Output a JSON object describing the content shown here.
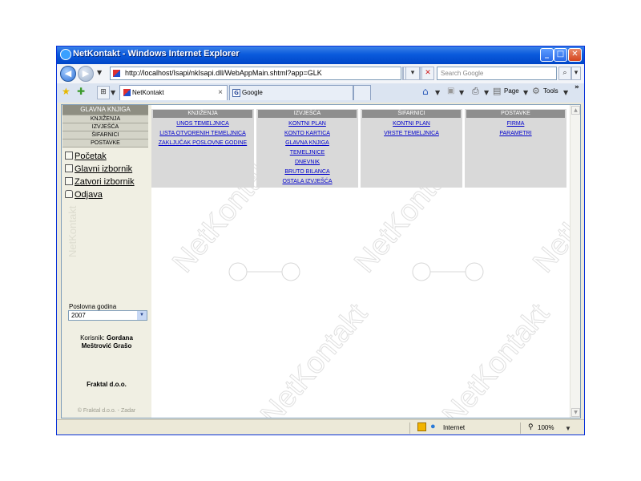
{
  "window": {
    "title": "NetKontakt - Windows Internet Explorer"
  },
  "toolbar": {
    "address": "http://localhost/Isapi/nkIsapi.dll/WebAppMain.shtml?app=GLK",
    "search_placeholder": "Search Google"
  },
  "tabs": [
    {
      "label": "NetKontakt",
      "close": "×"
    },
    {
      "label": "Google"
    }
  ],
  "command_bar": {
    "page": "Page",
    "tools": "Tools"
  },
  "sidebar": {
    "header": "GLAVNA KNJIGA",
    "menu": [
      "KNJIŽENJA",
      "IZVJEŠĆA",
      "ŠIFARNICI",
      "POSTAVKE"
    ],
    "links": [
      {
        "label": "Početak",
        "icon": "home-icon"
      },
      {
        "label": "Glavni izbornik",
        "icon": "menu-icon"
      },
      {
        "label": "Zatvori izbornik",
        "icon": "close-menu-icon"
      },
      {
        "label": "Odjava",
        "icon": "lock-icon"
      }
    ],
    "watermark": "NetKontakt",
    "year_label": "Poslovna godina",
    "year_value": "2007",
    "user_label": "Korisnik:",
    "user_name": "Gordana Meštrović Grašo",
    "company": "Fraktal d.o.o.",
    "copyright": "© Fraktal d.o.o. - Zadar"
  },
  "menu_columns": [
    {
      "header": "KNJIŽENJA",
      "items": [
        "UNOS TEMELJNICA",
        "LISTA OTVORENIH TEMELJNICA",
        "ZAKLJUČAK POSLOVNE GODINE"
      ]
    },
    {
      "header": "IZVJEŠĆA",
      "items": [
        "KONTNI PLAN",
        "KONTO KARTICA",
        "GLAVNA KNJIGA",
        "TEMELJNICE",
        "DNEVNIK",
        "BRUTO BILANCA",
        "OSTALA IZVJEŠĆA"
      ]
    },
    {
      "header": "ŠIFARNICI",
      "items": [
        "KONTNI PLAN",
        "VRSTE TEMELJNICA"
      ]
    },
    {
      "header": "POSTAVKE",
      "items": [
        "FIRMA",
        "PARAMETRI"
      ]
    }
  ],
  "watermark_text": "NetKontakt",
  "status": {
    "zone": "Internet",
    "zoom": "100%"
  }
}
